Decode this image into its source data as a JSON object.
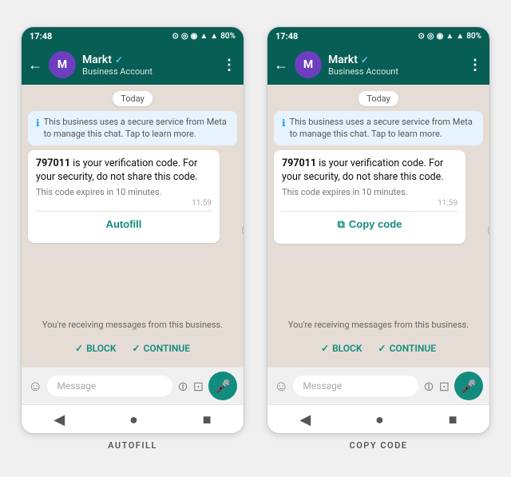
{
  "phones": [
    {
      "id": "autofill",
      "label": "AUTOFILL",
      "statusBar": {
        "time": "17:48",
        "icons": "📱 📱 📱 ▲ 80%"
      },
      "header": {
        "backLabel": "←",
        "avatarInitial": "M",
        "contactName": "Markt",
        "verifiedSymbol": "✓",
        "contactType": "Business Account",
        "menuIcon": "⋮"
      },
      "chat": {
        "dateBadge": "Today",
        "secureNotice": "This business uses a secure service from Meta to manage this chat. Tap to learn more.",
        "messageCode": "797011",
        "messageText1": " is your verification code. For your security, do not share this code.",
        "messageSubText": "This code expires in 10 minutes.",
        "messageTime": "11:59",
        "actionButtonLabel": "Autofill",
        "actionButtonType": "autofill",
        "businessNotice": "You're receiving messages from this business.",
        "blockLabel": "BLOCK",
        "continueLabel": "CONTINUE",
        "messagePlaceholder": "Message"
      }
    },
    {
      "id": "copycode",
      "label": "COPY CODE",
      "statusBar": {
        "time": "17:48",
        "icons": "📱 📱 📱 ▲ 80%"
      },
      "header": {
        "backLabel": "←",
        "avatarInitial": "M",
        "contactName": "Markt",
        "verifiedSymbol": "✓",
        "contactType": "Business Account",
        "menuIcon": "⋮"
      },
      "chat": {
        "dateBadge": "Today",
        "secureNotice": "This business uses a secure service from Meta to manage this chat. Tap to learn more.",
        "messageCode": "797011",
        "messageText1": " is your verification code. For your security, do not share this code.",
        "messageSubText": "This code expires in 10 minutes.",
        "messageTime": "11:59",
        "actionButtonLabel": "Copy code",
        "actionButtonType": "copy",
        "businessNotice": "You're receiving messages from this business.",
        "blockLabel": "BLOCK",
        "continueLabel": "CONTINUE",
        "messagePlaceholder": "Message"
      }
    }
  ]
}
